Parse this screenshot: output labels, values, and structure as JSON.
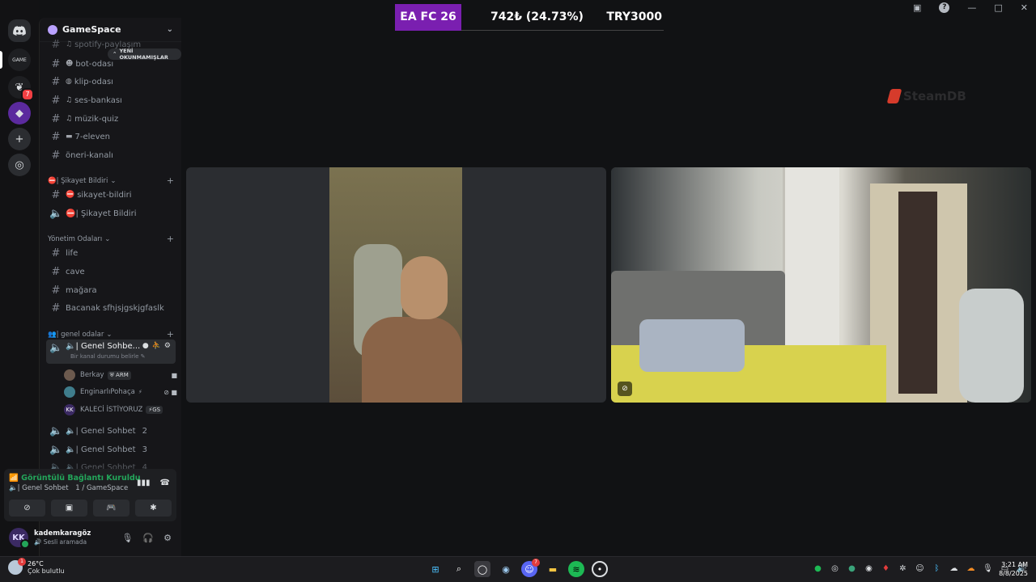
{
  "rail": {
    "unread_badge": "7"
  },
  "guild": {
    "name": "GameSpace"
  },
  "unread_pill": "YENİ OKUNMAMIŞLAR",
  "channels_top": [
    {
      "name": "spotify-paylaşım",
      "emoji": "♫"
    },
    {
      "name": "bot-odası",
      "emoji": "☻"
    },
    {
      "name": "klip-odası",
      "emoji": "◍"
    },
    {
      "name": "ses-bankası",
      "emoji": "♫"
    },
    {
      "name": "müzik-quiz",
      "emoji": "♫"
    },
    {
      "name": "7-eleven",
      "emoji": "▬"
    },
    {
      "name": "öneri-kanalı",
      "emoji": ""
    }
  ],
  "category_complaint": {
    "label": "⛔| Şikayet Bildiri",
    "channels": [
      {
        "name": "sikayet-bildiri",
        "emoji": "⛔"
      },
      {
        "name": "⛔| Şikayet Bildiri",
        "emoji": ""
      }
    ]
  },
  "category_admin": {
    "label": "Yönetim Odaları",
    "channels": [
      "life",
      "cave",
      "mağara",
      "Bacanak sfhjsjgskjgfaslk"
    ]
  },
  "category_general": {
    "label": "👥| genel odalar",
    "active_channel": "🔈| Genel Sohbe...",
    "active_subtitle": "Bir kanal durumu belirle ✎",
    "users": [
      {
        "name": "Berkay",
        "tag": "⛨ ARM",
        "initials": ""
      },
      {
        "name": "EnginarlıPohaça",
        "tag": "⚡",
        "initials": ""
      },
      {
        "name": "KALECİ İSTİYORUZ",
        "tag": "⚡GS",
        "initials": "KK"
      }
    ],
    "more_channels": [
      "🔈| Genel Sohbet",
      "🔈| Genel Sohbet",
      "🔈| Genel Sohbet"
    ],
    "more_channel_numbers": [
      "2",
      "3",
      "4"
    ]
  },
  "voice_panel": {
    "status": "Görüntülü Bağlantı Kuruldu",
    "channel": "🔈| Genel Sohbet",
    "guild": "1 / GameSpace"
  },
  "user": {
    "initials": "KK",
    "name": "kademkaragöz",
    "status": "🔊 Sesli aramada"
  },
  "overlay": {
    "game": "EA FC 26",
    "price": "742₺ (24.73%)",
    "currency": "TRY3000"
  },
  "watermark": "SteamDB",
  "taskbar": {
    "weather_temp": "26°C",
    "weather_desc": "Çok bulutlu",
    "weather_badge": "1",
    "discord_badge": "7",
    "time": "3:21 AM",
    "date": "8/8/2025"
  },
  "colors": {
    "accent_purple": "#7a1fb0",
    "online_green": "#23a55a",
    "badge_red": "#f23f43"
  }
}
